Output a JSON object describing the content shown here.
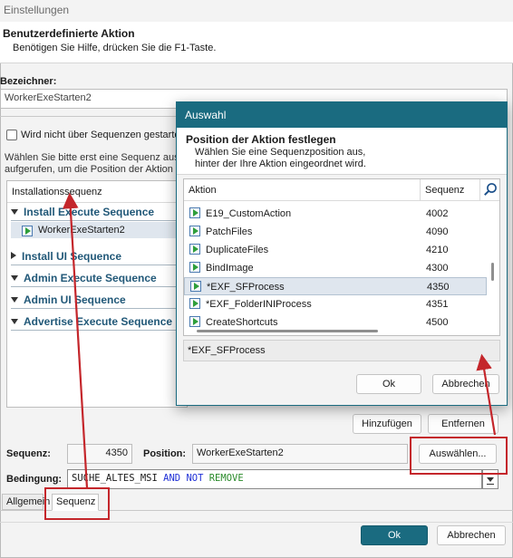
{
  "window": {
    "title": "Einstellungen",
    "header_title": "Benutzerdefinierte Aktion",
    "header_subtitle": "Benötigen Sie Hilfe, drücken Sie die F1-Taste."
  },
  "identifier": {
    "label": "Bezeichner:",
    "value": "WorkerExeStarten2"
  },
  "options": {
    "checkbox_label": "Wird nicht über Sequenzen gestartet",
    "info_line1": "Wählen Sie bitte erst eine Sequenz aus",
    "info_line2": "aufgerufen, um die Position der Aktion festzulegen."
  },
  "sequence_panel": {
    "header": "Installationssequenz",
    "groups": [
      {
        "label": "Install Execute Sequence",
        "expanded": true
      },
      {
        "label": "Install UI Sequence",
        "expanded": false
      },
      {
        "label": "Admin Execute Sequence",
        "expanded": false
      },
      {
        "label": "Admin UI Sequence",
        "expanded": false
      },
      {
        "label": "Advertise Execute Sequence",
        "expanded": false
      }
    ],
    "selected_item": "WorkerExeStarten2"
  },
  "buttons": {
    "add": "Hinzufügen",
    "remove": "Entfernen",
    "choose": "Auswählen...",
    "ok": "Ok",
    "cancel": "Abbrechen"
  },
  "sequence_fields": {
    "sequence_label": "Sequenz:",
    "sequence_value": "4350",
    "position_label": "Position:",
    "position_value": "WorkerExeStarten2",
    "condition_label": "Bedingung:",
    "condition_parts": [
      {
        "text": "SUCHE_ALTES_MSI ",
        "style": "plain"
      },
      {
        "text": "AND NOT ",
        "style": "keyword"
      },
      {
        "text": "REMOVE",
        "style": "property"
      }
    ]
  },
  "tabs": {
    "general": "Allgemein",
    "sequence": "Sequenz"
  },
  "dialog": {
    "title": "Auswahl",
    "header_title": "Position der Aktion festlegen",
    "header_line1": "Wählen Sie eine Sequenzposition aus,",
    "header_line2": "hinter der Ihre Aktion eingeordnet wird.",
    "col_action": "Aktion",
    "col_sequence": "Sequenz",
    "rows": [
      {
        "name": "E19_CustomAction",
        "seq": "4002"
      },
      {
        "name": "PatchFiles",
        "seq": "4090"
      },
      {
        "name": "DuplicateFiles",
        "seq": "4210"
      },
      {
        "name": "BindImage",
        "seq": "4300"
      },
      {
        "name": "*EXF_SFProcess",
        "seq": "4350",
        "selected": true
      },
      {
        "name": "*EXF_FolderINIProcess",
        "seq": "4351"
      },
      {
        "name": "CreateShortcuts",
        "seq": "4500"
      }
    ],
    "selection": "*EXF_SFProcess",
    "ok": "Ok",
    "cancel": "Abbrechen"
  },
  "colors": {
    "accent": "#1a6b80",
    "group_text": "#215878",
    "annotation": "#c4262b"
  }
}
